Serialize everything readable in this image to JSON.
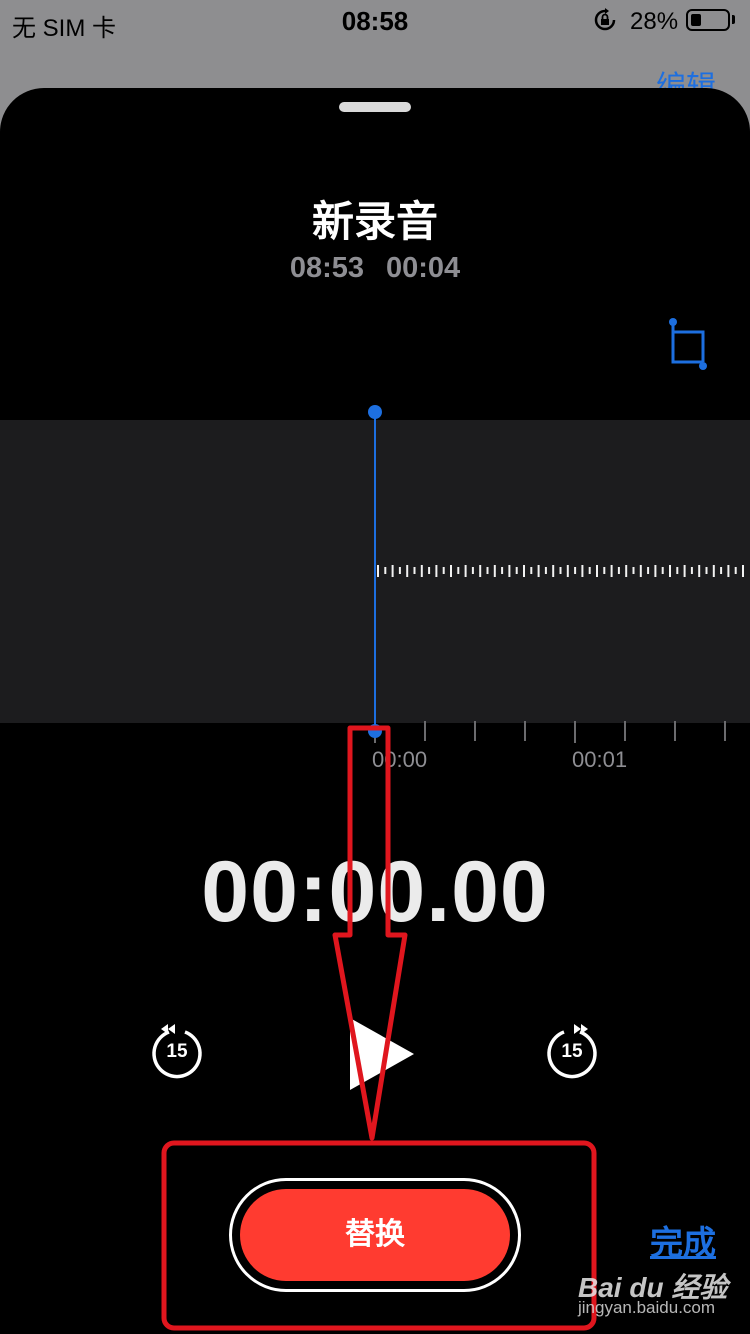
{
  "status_bar": {
    "carrier": "无 SIM 卡",
    "time": "08:58",
    "battery_percent": "28%",
    "battery_level": 0.28
  },
  "background": {
    "edit_label": "编辑"
  },
  "recording": {
    "title": "新录音",
    "date": "08:53",
    "duration": "00:04"
  },
  "timeline": {
    "labels": [
      "00:00",
      "00:01"
    ]
  },
  "player": {
    "timer": "00:00.00",
    "skip_back": "15",
    "skip_forward": "15"
  },
  "actions": {
    "replace_label": "替换",
    "done_label": "完成"
  },
  "watermark": {
    "logo": "Bai du 经验",
    "site": "jingyan.baidu.com"
  },
  "colors": {
    "accent": "#1d6fe0",
    "record_red": "#ff3b30",
    "annotation_red": "#e0161e"
  },
  "icons": [
    "orientation-lock-icon",
    "battery-icon",
    "crop-icon",
    "skip-back-15-icon",
    "play-icon",
    "skip-forward-15-icon"
  ]
}
